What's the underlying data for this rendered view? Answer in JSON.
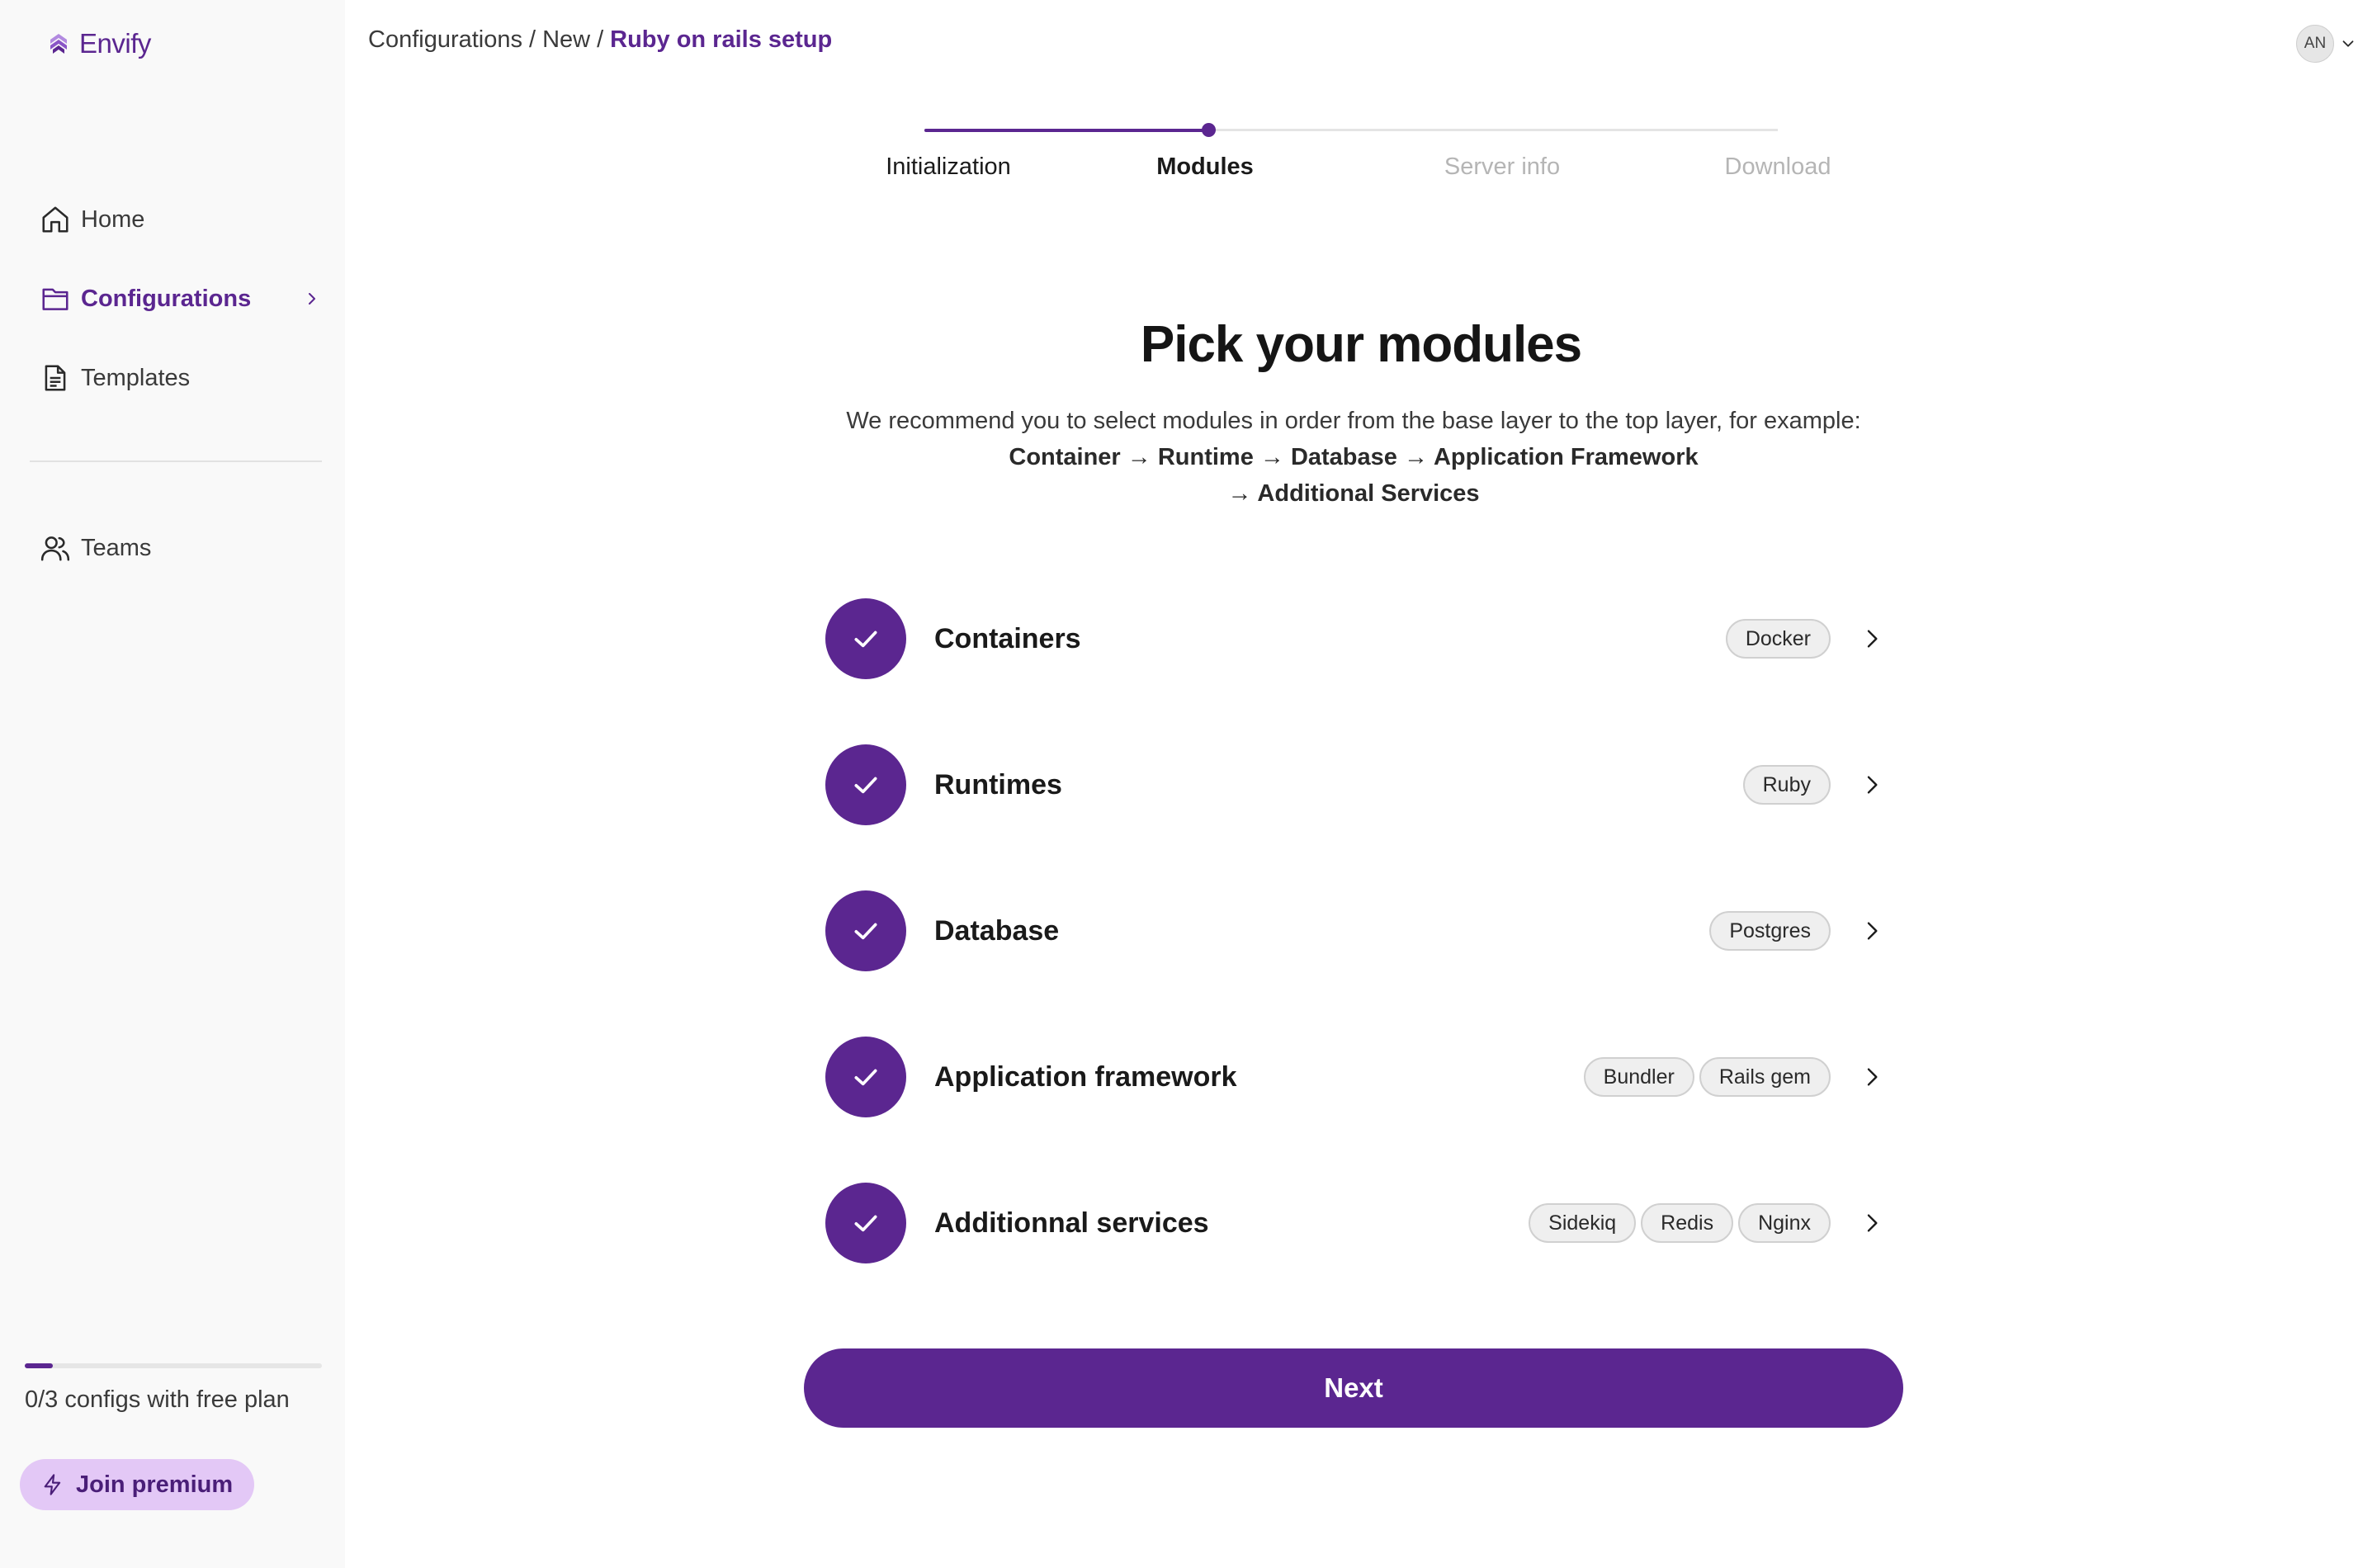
{
  "app": {
    "name": "Envify"
  },
  "sidebar": {
    "items": [
      {
        "label": "Home",
        "icon": "home-icon",
        "active": false
      },
      {
        "label": "Configurations",
        "icon": "folder-icon",
        "active": true
      },
      {
        "label": "Templates",
        "icon": "document-icon",
        "active": false
      }
    ],
    "teams": {
      "label": "Teams",
      "icon": "users-icon"
    },
    "plan": {
      "text": "0/3 configs with free plan",
      "progress_fraction": 0
    },
    "premium_button": "Join premium"
  },
  "header": {
    "breadcrumb": [
      "Configurations",
      "New",
      "Ruby on rails setup"
    ],
    "breadcrumb_sep": "/",
    "avatar": "AN"
  },
  "stepper": {
    "steps": [
      {
        "label": "Initialization",
        "state": "done"
      },
      {
        "label": "Modules",
        "state": "active"
      },
      {
        "label": "Server info",
        "state": "todo"
      },
      {
        "label": "Download",
        "state": "todo"
      }
    ]
  },
  "main": {
    "title": "Pick your modules",
    "subtitle_line1": "We recommend you to select modules in order from the base layer to the top layer, for example:",
    "subtitle_line2": "Container → Runtime → Database → Application Framework",
    "subtitle_line3": "→ Additional Services",
    "modules": [
      {
        "name": "Containers",
        "tags": [
          "Docker"
        ]
      },
      {
        "name": "Runtimes",
        "tags": [
          "Ruby"
        ]
      },
      {
        "name": "Database",
        "tags": [
          "Postgres"
        ]
      },
      {
        "name": "Application framework",
        "tags": [
          "Bundler",
          "Rails gem"
        ]
      },
      {
        "name": "Additionnal services",
        "tags": [
          "Sidekiq",
          "Redis",
          "Nginx"
        ]
      }
    ],
    "next_button": "Next"
  },
  "colors": {
    "accent": "#5b2690",
    "premium_bg": "#e3c8f6",
    "sidebar_bg": "#f9f9f9"
  }
}
